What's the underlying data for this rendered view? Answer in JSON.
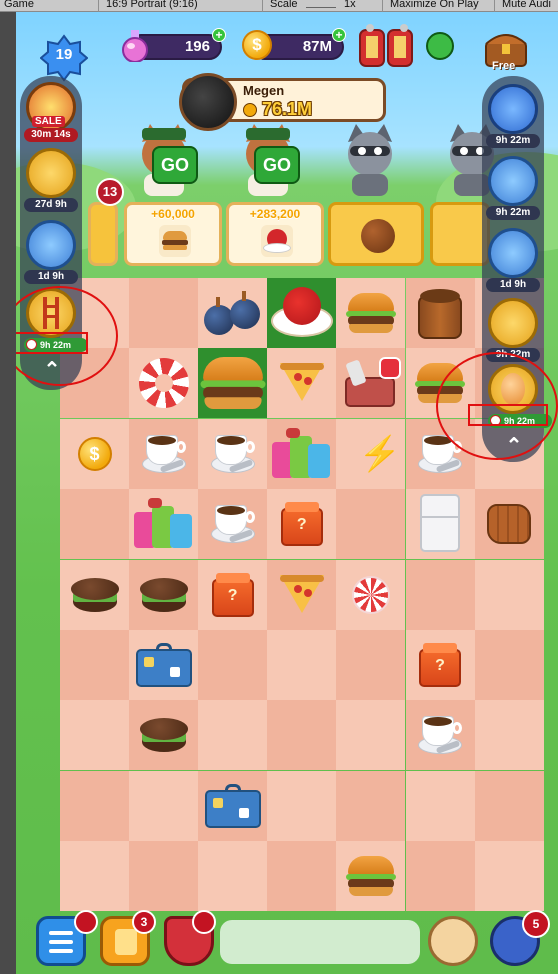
{
  "editor": {
    "game_tab": "Game",
    "aspect": "16:9 Portrait (9:16)",
    "scale_label": "Scale",
    "scale_value": "1x",
    "maximize": "Maximize On Play",
    "mute": "Mute Audi"
  },
  "hud": {
    "level": "19",
    "potions": "196",
    "coins": "87M",
    "coin_symbol": "$",
    "free_label": "Free"
  },
  "opponent": {
    "name": "Megen",
    "gold": "76.1M"
  },
  "characters": {
    "go_label": "GO"
  },
  "orders": [
    {
      "reward": "+60,000"
    },
    {
      "reward": "+283,200"
    }
  ],
  "left_panel": {
    "sale_label": "SALE",
    "sale_timer": "30m 14s",
    "slot_timers": [
      "27d 9h",
      "1d 9h"
    ],
    "active_timer": "9h 22m",
    "counter": "13"
  },
  "right_panel": {
    "slot_timers": [
      "9h 22m",
      "9h 22m",
      "1d 9h",
      "9h 22m"
    ],
    "active_timer": "9h 22m"
  },
  "board_coin": "$",
  "bottom": {
    "cards_badge": "3",
    "gifts_badge": "5"
  },
  "colors": {
    "board_light": "#f7c8b4",
    "board_dark": "#f1b49d",
    "highlight_green": "#2f8f2e",
    "annotation_red": "#e01010"
  }
}
